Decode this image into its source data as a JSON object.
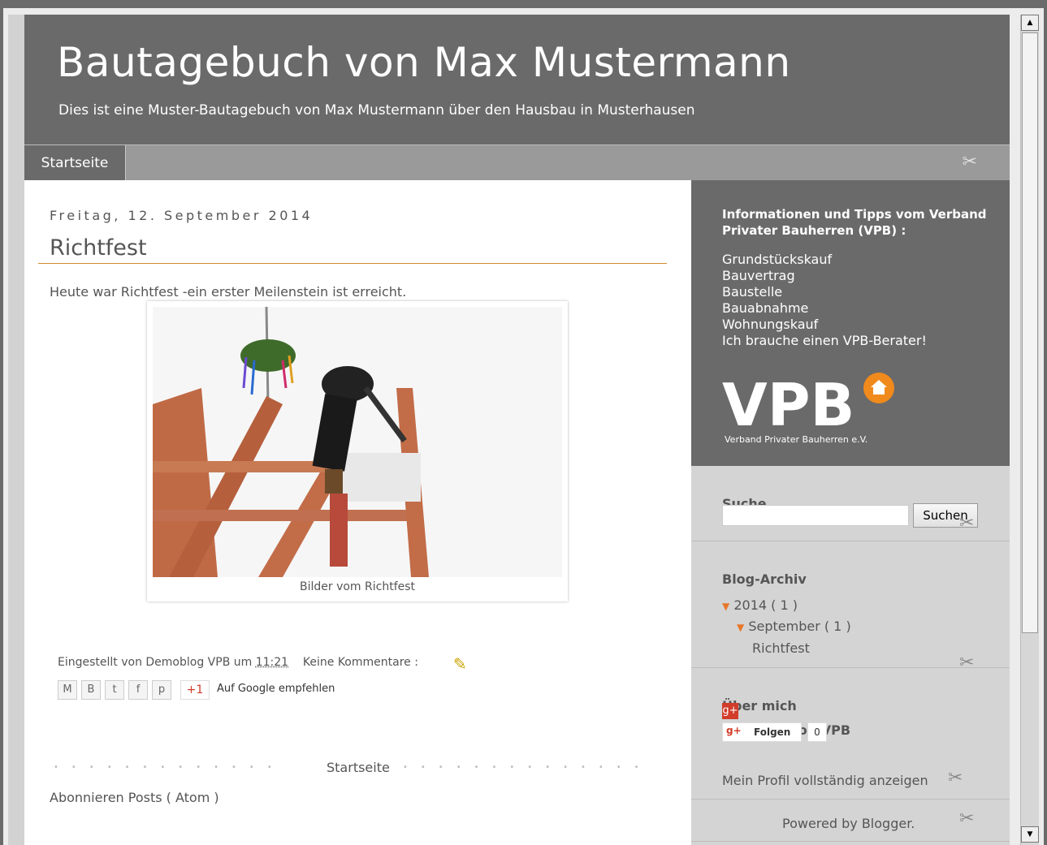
{
  "blog": {
    "title": "Bautagebuch von Max Mustermann",
    "description": "Dies ist eine Muster-Bautagebuch von Max Mustermann über den Hausbau in Musterhausen"
  },
  "nav": {
    "tab_home": "Startseite"
  },
  "post": {
    "date": "Freitag, 12. September 2014",
    "title": "Richtfest",
    "body": "Heute war Richtfest -ein erster Meilenstein ist erreicht.",
    "image_caption": "Bilder vom Richtfest",
    "posted_by_prefix": "Eingestellt von Demoblog VPB um",
    "time": "11:21",
    "comments": "Keine Kommentare :",
    "share_gplus": "+1",
    "share_google": "Auf Google empfehlen"
  },
  "pager": {
    "home": "Startseite"
  },
  "subscribe": "Abonnieren Posts ( Atom )",
  "sidebar": {
    "info_title": "Informationen und Tipps vom Verband Privater Bauherren (VPB) :",
    "info_links": [
      "Grundstückskauf",
      "Bauvertrag",
      "Baustelle",
      "Bauabnahme",
      "Wohnungskauf",
      "Ich brauche einen VPB-Berater!"
    ],
    "logo_text": "VPB",
    "logo_sub": "Verband Privater Bauherren e.V.",
    "search_title": "Suche",
    "search_button": "Suchen",
    "archive_title": "Blog-Archiv",
    "archive_year": "2014 ( 1 )",
    "archive_month": "September ( 1 )",
    "archive_post": "Richtfest",
    "about_title": "Über mich",
    "profile_name": "Demoblog VPB",
    "follow_label": "Folgen",
    "follow_count": "0",
    "profile_link": "Mein Profil vollständig anzeigen",
    "powered": "Powered by Blogger."
  },
  "colors": {
    "header_bg": "#6a6a6a",
    "accent": "#e8772a",
    "title_rule": "#d18b2e"
  }
}
